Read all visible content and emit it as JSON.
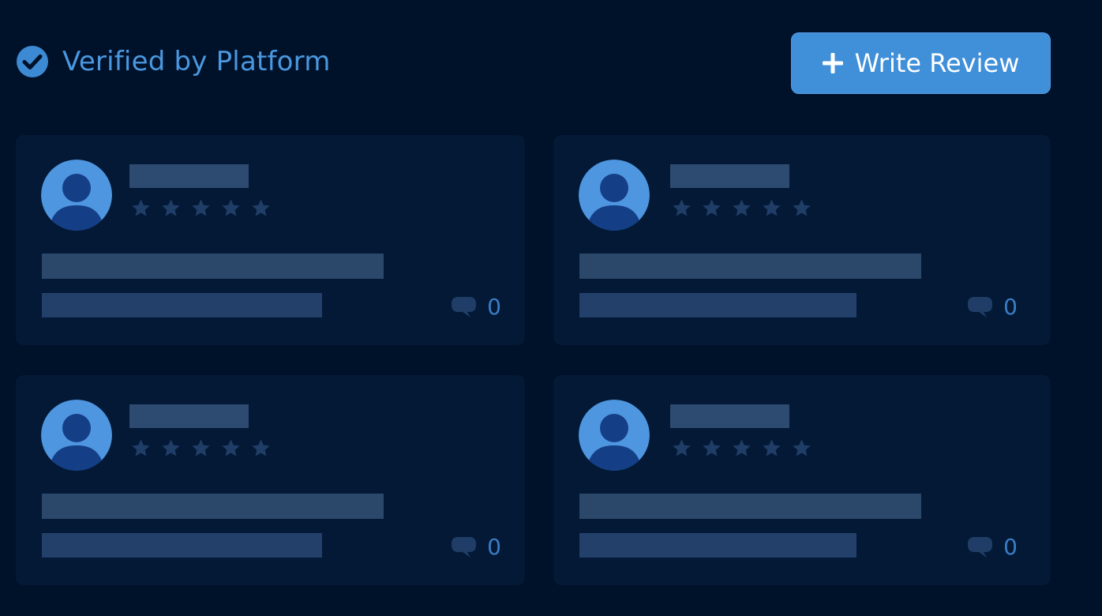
{
  "header": {
    "verified_label": "Verified by Platform",
    "verified_icon": "check-circle-icon",
    "write_review_label": "Write Review",
    "write_review_icon": "plus-icon"
  },
  "colors": {
    "background": "#00112a",
    "card": "#031936",
    "accent": "#3f8fd9",
    "verified_text": "#4a98df",
    "placeholder": "#2d4a71",
    "star": "#1f3d66",
    "comment": "#3c7cc6"
  },
  "reviews": [
    {
      "comment_count": "0"
    },
    {
      "comment_count": "0"
    },
    {
      "comment_count": "0"
    },
    {
      "comment_count": "0"
    }
  ]
}
